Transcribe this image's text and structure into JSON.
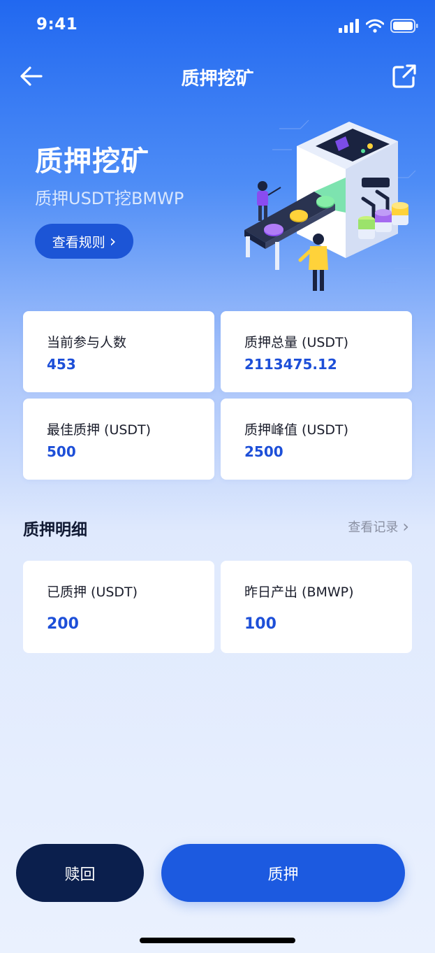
{
  "status_bar": {
    "time": "9:41"
  },
  "nav": {
    "title": "质押挖矿",
    "back_icon": "arrow-left-icon",
    "share_icon": "external-link-icon"
  },
  "hero": {
    "title": "质押挖矿",
    "subtitle": "质押USDT挖BMWP",
    "rules_button": "查看规则",
    "rules_chevron": "›"
  },
  "stats": [
    {
      "label": "当前参与人数",
      "value": "453"
    },
    {
      "label": "质押总量 (USDT)",
      "value": "2113475.12"
    },
    {
      "label": "最佳质押 (USDT)",
      "value": "500"
    },
    {
      "label": "质押峰值 (USDT)",
      "value": "2500"
    }
  ],
  "section": {
    "title": "质押明细",
    "link": "查看记录",
    "chevron": "›"
  },
  "details": [
    {
      "label": "已质押 (USDT)",
      "value": "200"
    },
    {
      "label": "昨日产出 (BMWP)",
      "value": "100"
    }
  ],
  "actions": {
    "redeem": "赎回",
    "stake": "质押"
  },
  "colors": {
    "primary": "#1c5ae0",
    "dark": "#0b1f4d",
    "value": "#1d4fd8"
  }
}
